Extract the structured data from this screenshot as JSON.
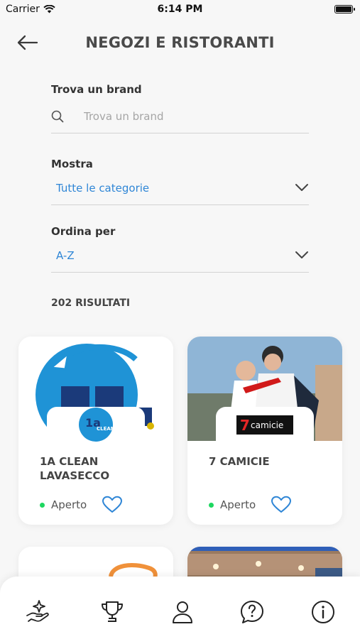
{
  "status_bar": {
    "carrier": "Carrier",
    "time": "6:14 PM"
  },
  "header": {
    "title": "NEGOZI E RISTORANTI"
  },
  "search": {
    "label": "Trova un brand",
    "placeholder": "Trova un brand",
    "value": ""
  },
  "filter_show": {
    "label": "Mostra",
    "value": "Tutte le categorie"
  },
  "filter_sort": {
    "label": "Ordina per",
    "value": "A-Z"
  },
  "results_count": "202 RISULTATI",
  "stores": [
    {
      "name": "1A CLEAN LAVASECCO",
      "status": "Aperto",
      "logo_text": "1a",
      "logo_subtext": "CLEAN"
    },
    {
      "name": "7 CAMICIE",
      "status": "Aperto",
      "logo_text": "7",
      "logo_subtext": "camicie"
    }
  ],
  "colors": {
    "accent": "#2f86d6",
    "open_dot": "#1ed760"
  },
  "tabbar": {
    "items": [
      {
        "icon": "hand-sparkle-icon"
      },
      {
        "icon": "trophy-icon"
      },
      {
        "icon": "user-icon"
      },
      {
        "icon": "question-icon"
      },
      {
        "icon": "info-icon"
      }
    ]
  }
}
